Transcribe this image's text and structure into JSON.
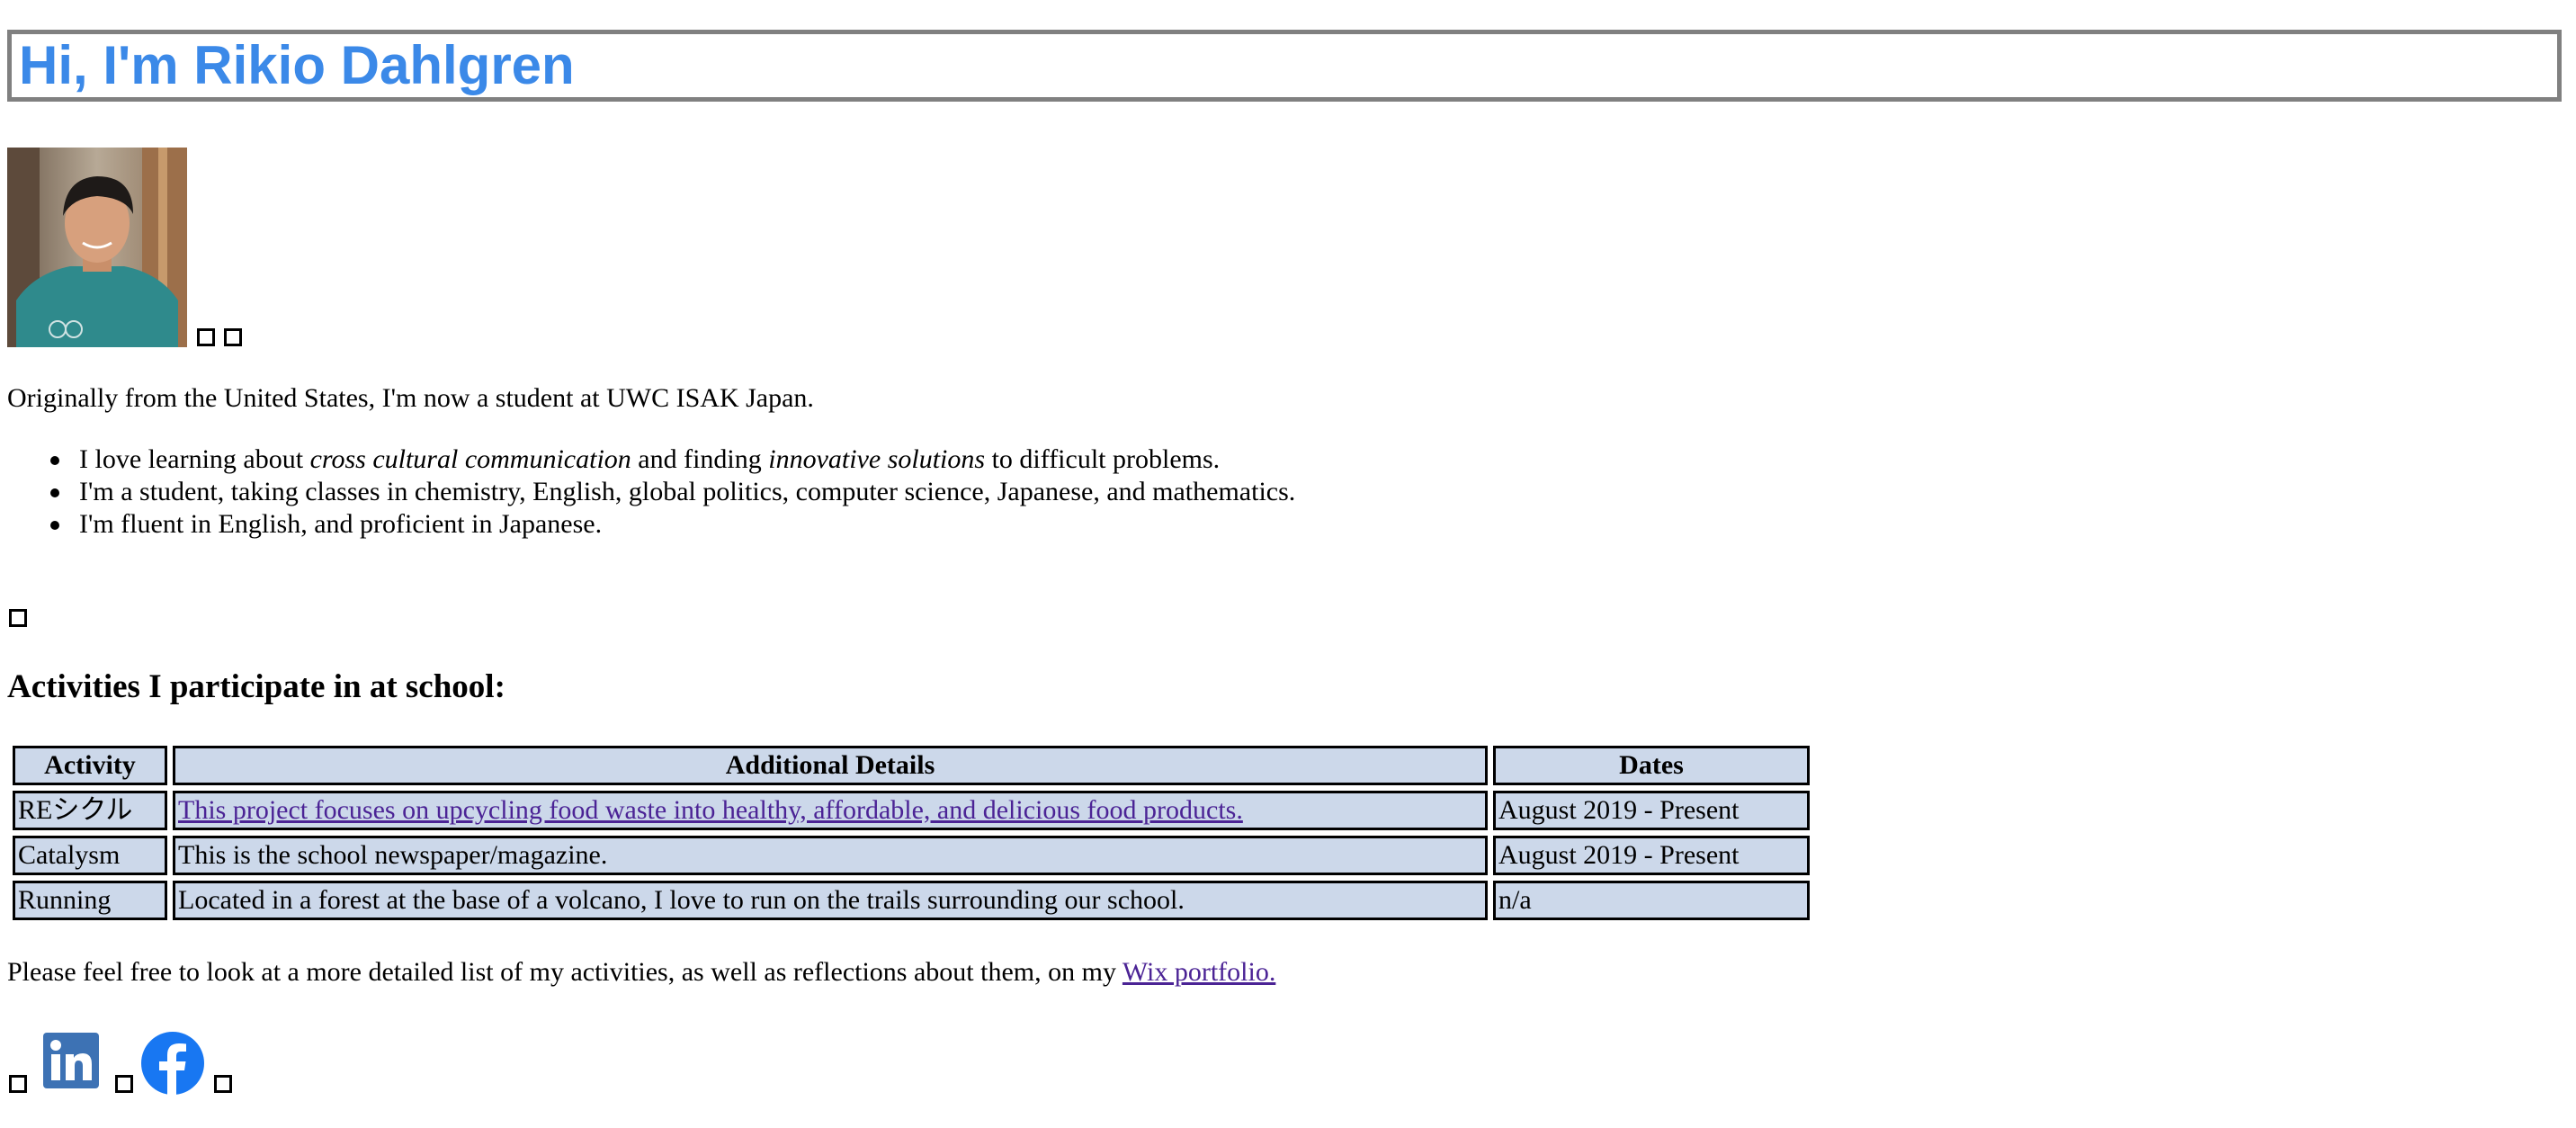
{
  "header": {
    "title": "Hi, I'm Rikio Dahlgren"
  },
  "profile": {
    "photo_alt": "Rikio Dahlgren",
    "intro": "Originally from the United States, I'm now a student at UWC ISAK Japan."
  },
  "bullets": {
    "item1": {
      "part1": "I love learning about ",
      "em1": "cross cultural communication",
      "part2": " and finding ",
      "em2": "innovative solutions",
      "part3": " to difficult problems."
    },
    "item2": "I'm a student, taking classes in chemistry, English, global politics, computer science, Japanese, and mathematics.",
    "item3": "I'm fluent in English, and proficient in Japanese."
  },
  "activities": {
    "heading": "Activities I participate in at school:",
    "columns": [
      "Activity",
      "Additional Details",
      "Dates"
    ],
    "rows": [
      {
        "activity": "REシクル",
        "details": "This project focuses on upcycling food waste into healthy, affordable, and delicious food products.",
        "details_is_link": true,
        "dates": "August 2019 - Present"
      },
      {
        "activity": "Catalysm",
        "details": "This is the school newspaper/magazine.",
        "details_is_link": false,
        "dates": "August 2019 - Present"
      },
      {
        "activity": "Running",
        "details": "Located in a forest at the base of a volcano, I love to run on the trails surrounding our school.",
        "details_is_link": false,
        "dates": "n/a"
      }
    ]
  },
  "footer": {
    "text": "Please feel free to look at a more detailed list of my activities, as well as reflections about them, on my ",
    "link_label": "Wix portfolio."
  },
  "colors": {
    "title": "#3b89e8",
    "table_cell_bg": "#ccd8ea",
    "visited_link": "#4b2395",
    "linkedin": "#3d72b4",
    "facebook": "#1877f2"
  },
  "icons": {
    "linkedin": "linkedin-icon",
    "facebook": "facebook-icon",
    "broken_image": "broken-image-icon"
  }
}
